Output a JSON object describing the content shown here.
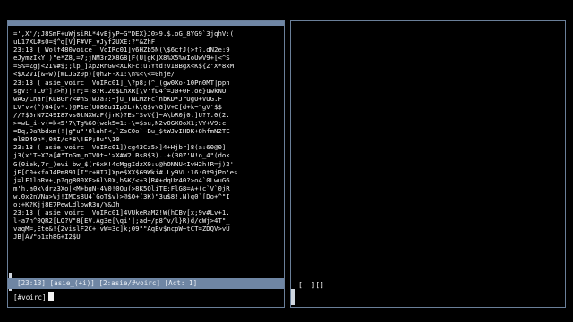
{
  "left_pane": {
    "log_lines": [
      "=',X'/;J8SmF+uWjsiRL*4vBjyP~G\"DEX}J0>9.$.oG_8YG9`3jqhV:(",
      "uL17XL#s0=$^q[V]F#VF_vJyf2UXE:?\"&ZhF",
      "23:13 ( Wolf480voice  VoIRc01]v6HZb5N(\\$6cfJ(>f?.dN2e:9",
      "eJymzIkY')\"e*Z8,=7;jNM3r2X8G8[F(U[gK]X8%X5%wIoUwV9+[<^S",
      "=S%=Zgj<2IV#$;;lp_]Xp2RnGw<XLkFc;u?Ytd!VI8BgX<K${Z'X*8xM",
      "<$X2V1[&+w)[WLJGz0p)[Qh2F-X1:\\n%<\\<=0hje/",
      "23:13 ( asie_voirc  VoIRc01]_\\?p8;(^_(gw0Xo-10Pn0MT|ppn",
      "sgV:'TL0^]?>h)|!r;=T87R.26$LnXR[\\v'fD4^=J0+0F.oe}uwkNU",
      "wAG/Lnar[KuBGr?<#nS!wJa?:~ju_TNLMzFc`nbKD*JrUgO+VUG.F",
      "LV\"v>(^)G4[v*.)@P1e(U080u1IpJL)k\\Q$v\\G]V+C[d+k~\"gV'$$",
      "//?$5rN7Z49I87vs0tNXWzF(jrK)?Es\"SvV{]~A\\bR0j0.]U??.0(2.",
      ">=wL_i-v(=k<5'7\\Tg%60(wqk5=1:-\\=$su,N2v0GX0oX1;VY+V9:c",
      "=Dq,9aRbdxm(!|g\"u\"'0lahF<,`ZsC0o`~Bu_$tWJvIHDK+8hfmN2TE",
      "el8D40n*,0#I/c*8\\!EP;8u\"\\10",
      "23:13 ( asie_voirc  VoIRc01])cg43Cz5x]4+Hjbr]8(a:60@0]",
      "j3(x'T~X7a[#\"TnGm_nTV0t~'>X#W2.Bs8$3)..+(30Z'N!o_4\"(dok",
      "G(0iek,7r_)evi bw_$(r6xK!4cMggIdzX0:u@hONNU<IvH2h!R=j)2'",
      "jE[C0+kfoJ4Pm891[I\"r+HI7]Xpe$XX$G9Wki#.Ly9VL:16:0t9jPn'es",
      "j=lF1loRv+,p?qg800XF>6l\\0X,b&K/<+3[R#+dqUz40?>o4`0LwuG6",
      "m'h,a0x\\drz3Xo|<M+bgN-4V0!0Ou(>8K5QliTE:FlG8=A+(c`V`0jR",
      "w,0x2nVNa>Vj!IMCs8U4`GoT$v)>@$Q+(3K)\"3u$8!.N)q0`[Do+^\"I",
      "o:+K?Kjj8E7PewLdlpwR3u/Y&Jh",
      "23:13 ( asie_voirc  VoIRc01]4VUkeRaMZ!W(hCBv[x;9v#Lv+1.",
      "l-a7n^0QR2[LO?V\"8[EV.Ag3e[\\qi'];ad~/p8^v/l}R)d/cWj>4T\"_",
      "vaqM=,Ete&!{2vislF2C+:vW=3c]k;09\"\"AqEv$ncpW~tCT=ZDQV>vU",
      "JB|AV\"o1xh8G+I2$U"
    ],
    "status_bar": "[23:13] [asie_(+i)] [2:asie/#voirc] [Act: 1]",
    "input_prompt": "[#voirc]"
  },
  "right_pane": {
    "cursor_text": "[  ][]"
  }
}
